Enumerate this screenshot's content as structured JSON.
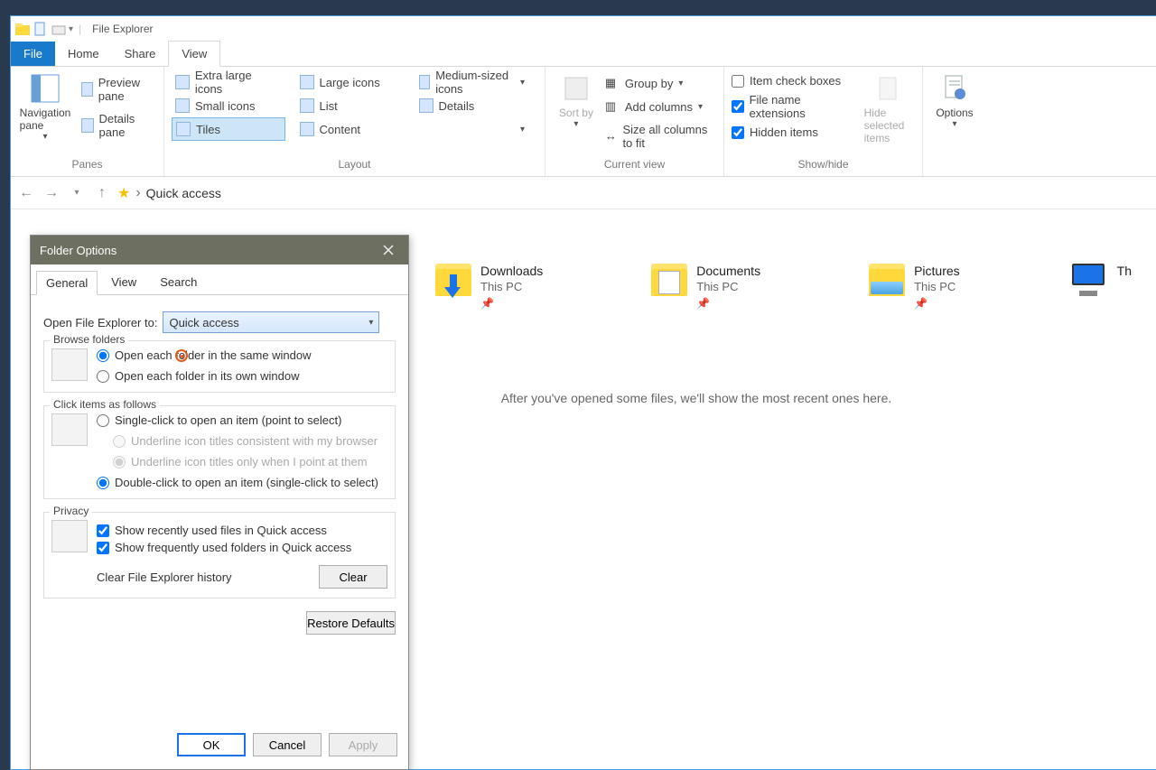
{
  "window": {
    "title": "File Explorer"
  },
  "tabs": {
    "file": "File",
    "home": "Home",
    "share": "Share",
    "view": "View"
  },
  "ribbon": {
    "panes": {
      "label": "Panes",
      "nav": "Navigation pane",
      "preview": "Preview pane",
      "details": "Details pane"
    },
    "layout": {
      "label": "Layout",
      "xl": "Extra large icons",
      "large": "Large icons",
      "medium": "Medium-sized icons",
      "small": "Small icons",
      "list": "List",
      "details": "Details",
      "tiles": "Tiles",
      "content": "Content"
    },
    "current": {
      "label": "Current view",
      "sort": "Sort by",
      "group": "Group by",
      "addcols": "Add columns",
      "sizecols": "Size all columns to fit"
    },
    "showhide": {
      "label": "Show/hide",
      "itemchk": "Item check boxes",
      "ext": "File name extensions",
      "hidden": "Hidden items",
      "hidesel": "Hide selected items"
    },
    "options": "Options"
  },
  "address": {
    "quickaccess": "Quick access"
  },
  "items": {
    "downloads": {
      "name": "Downloads",
      "loc": "This PC"
    },
    "documents": {
      "name": "Documents",
      "loc": "This PC"
    },
    "pictures": {
      "name": "Pictures",
      "loc": "This PC"
    },
    "thispc": {
      "name": "Th",
      "loc": ""
    }
  },
  "recent_msg": "After you've opened some files, we'll show the most recent ones here.",
  "dialog": {
    "title": "Folder Options",
    "tabs": {
      "general": "General",
      "view": "View",
      "search": "Search"
    },
    "open_label": "Open File Explorer to:",
    "open_value": "Quick access",
    "browse": {
      "legend": "Browse folders",
      "same": "Open each folder in the same window",
      "own": "Open each folder in its own window"
    },
    "click": {
      "legend": "Click items as follows",
      "single": "Single-click to open an item (point to select)",
      "ul_browser": "Underline icon titles consistent with my browser",
      "ul_point": "Underline icon titles only when I point at them",
      "double": "Double-click to open an item (single-click to select)"
    },
    "privacy": {
      "legend": "Privacy",
      "recent_files": "Show recently used files in Quick access",
      "freq_folders": "Show frequently used folders in Quick access",
      "clear_label": "Clear File Explorer history",
      "clear_btn": "Clear"
    },
    "restore": "Restore Defaults",
    "ok": "OK",
    "cancel": "Cancel",
    "apply": "Apply"
  }
}
